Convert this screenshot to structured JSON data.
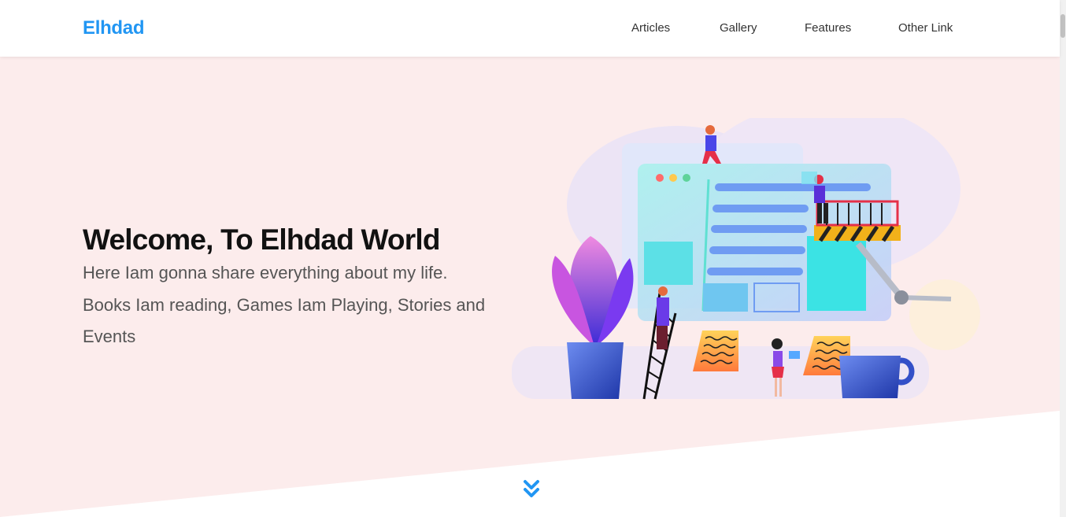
{
  "header": {
    "logo": "Elhdad",
    "nav": [
      {
        "label": "Articles"
      },
      {
        "label": "Gallery"
      },
      {
        "label": "Features"
      },
      {
        "label": "Other Link"
      }
    ]
  },
  "hero": {
    "title": "Welcome, To Elhdad World",
    "line1": "Here Iam gonna share everything about my life.",
    "line2": "Books Iam reading, Games Iam Playing, Stories and Events"
  },
  "colors": {
    "accent": "#2196f3",
    "hero_background": "#fcecec"
  },
  "icons": {
    "scroll_down": "double-chevron-down-icon"
  }
}
